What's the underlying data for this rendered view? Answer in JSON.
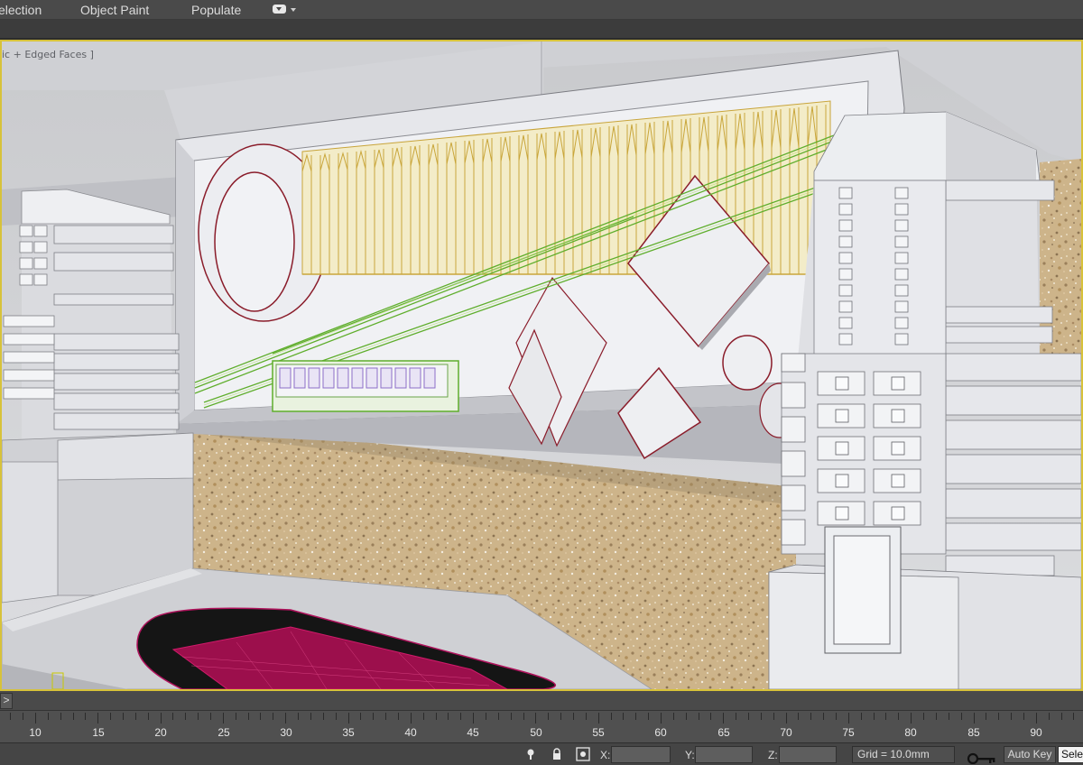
{
  "menu": {
    "items": [
      {
        "label": "election"
      },
      {
        "label": "Object Paint"
      },
      {
        "label": "Populate"
      }
    ],
    "dropdown_icon": "toggle-dropdown-icon"
  },
  "viewport": {
    "label": "ic + Edged Faces ]",
    "border_color": "#d7c23a",
    "background_color": "#d6d6d9"
  },
  "timeline": {
    "back_button": ">",
    "ticks": [
      "10",
      "15",
      "20",
      "25",
      "30",
      "35",
      "40",
      "45",
      "50",
      "55",
      "60",
      "65",
      "70",
      "75",
      "80",
      "85",
      "90"
    ]
  },
  "status": {
    "icons": [
      "lock-pin-icon",
      "lock-icon",
      "absolute-mode-icon"
    ],
    "x_label": "X:",
    "y_label": "Y:",
    "z_label": "Z:",
    "x_value": "",
    "y_value": "",
    "z_value": "",
    "grid": "Grid = 10.0mm",
    "key_icon": "set-key-icon",
    "auto_key": "Auto Key",
    "selection": "Selec"
  }
}
